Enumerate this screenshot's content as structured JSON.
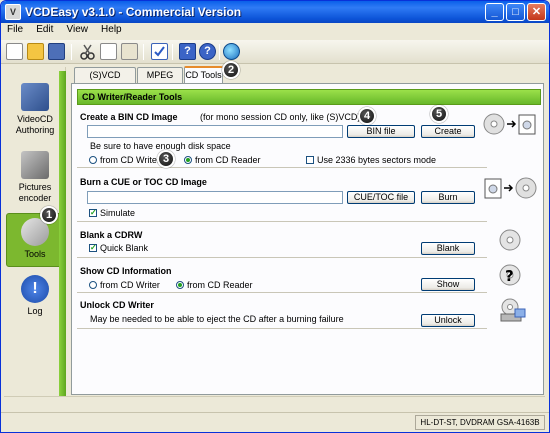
{
  "window": {
    "title": "VCDEasy v3.1.0 - Commercial Version",
    "min": "_",
    "max": "□",
    "close": "✕"
  },
  "menu": [
    "File",
    "Edit",
    "View",
    "Help"
  ],
  "sidebar": [
    {
      "label": "VideoCD Authoring",
      "icon": "film-disc-icon"
    },
    {
      "label": "Pictures encoder",
      "icon": "film-picture-icon"
    },
    {
      "label": "Tools",
      "icon": "tools-icon"
    },
    {
      "label": "Log",
      "icon": "log-info-icon"
    }
  ],
  "tabs": [
    "(S)VCD Build/Rip",
    "MPEG Tools",
    "CD Tools"
  ],
  "section_title": "CD Writer/Reader Tools",
  "bin": {
    "title": "Create a BIN CD Image",
    "note": "(for mono session CD only, like (S)VCD)",
    "hint": "Be sure to have enough disk space",
    "value": "",
    "file_button": "BIN file",
    "create_button": "Create",
    "radio_writer": "from CD Writer",
    "radio_reader": "from CD Reader",
    "checkbox_2336": "Use 2336 bytes sectors mode"
  },
  "burn": {
    "title": "Burn a CUE or TOC CD Image",
    "value": "",
    "file_button": "CUE/TOC file",
    "burn_button": "Burn",
    "checkbox_simulate": "Simulate"
  },
  "blank": {
    "title": "Blank a CDRW",
    "checkbox_quick": "Quick Blank",
    "button": "Blank"
  },
  "info": {
    "title": "Show CD Information",
    "radio_writer": "from CD Writer",
    "radio_reader": "from CD Reader",
    "button": "Show"
  },
  "unlock": {
    "title": "Unlock CD Writer",
    "note": "May be needed to be able to eject the CD after a burning failure",
    "button": "Unlock"
  },
  "status": {
    "drive": "HL-DT-ST, DVDRAM GSA-4163B"
  },
  "callouts": [
    "1",
    "2",
    "3",
    "4",
    "5"
  ]
}
